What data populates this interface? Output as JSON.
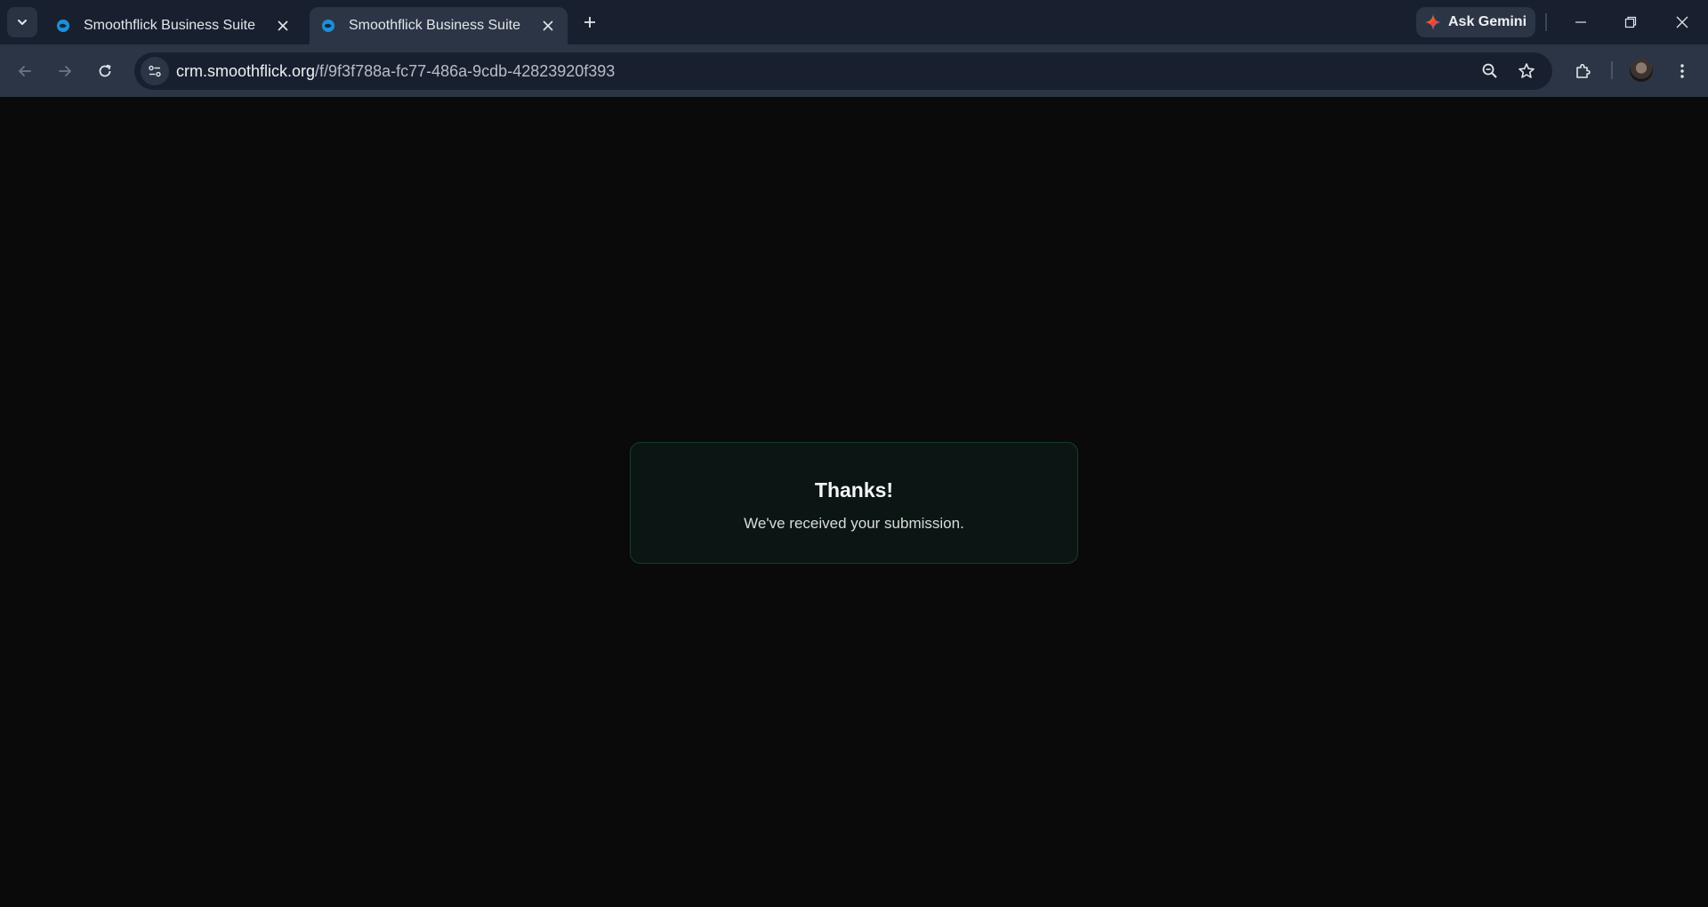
{
  "browser": {
    "tabs": [
      {
        "title": "Smoothflick Business Suite",
        "active": false
      },
      {
        "title": "Smoothflick Business Suite",
        "active": true
      }
    ],
    "gemini_label": "Ask Gemini",
    "url_host": "crm.smoothflick.org",
    "url_path": "/f/9f3f788a-fc77-486a-9cdb-42823920f393"
  },
  "page": {
    "heading": "Thanks!",
    "message": "We've received your submission."
  },
  "colors": {
    "page_bg": "#0a0a0a",
    "card_bg": "#0b1614",
    "card_border": "#1b3a2e",
    "toolbar_bg": "#2c3546",
    "tabstrip_bg": "#18202f"
  }
}
